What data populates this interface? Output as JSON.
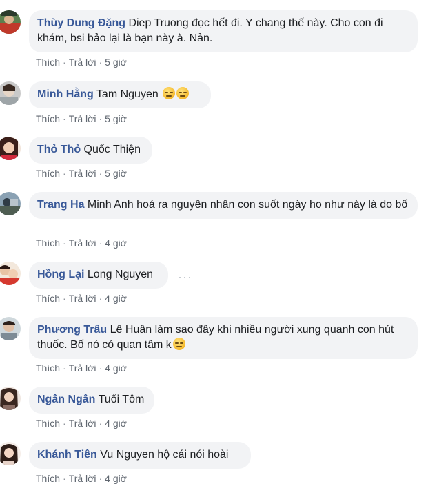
{
  "comments": [
    {
      "author": "Thùy Dung Đặng",
      "text": "Diep Truong đọc hết đi. Y chang thế này. Cho con đi khám, bsi bảo lại là bạn này à. Nản.",
      "like_label": "Thích",
      "reply_label": "Trả lời",
      "time": "5 giờ",
      "has_emoji": false
    },
    {
      "author": "Minh Hằng",
      "text": "Tam Nguyen",
      "like_label": "Thích",
      "reply_label": "Trả lời",
      "time": "5 giờ",
      "emojis": [
        "unamused-emoji",
        "unamused-emoji"
      ]
    },
    {
      "author": "Thỏ Thỏ",
      "text": "Quốc Thiện",
      "like_label": "Thích",
      "reply_label": "Trả lời",
      "time": "5 giờ"
    },
    {
      "author": "Trang Ha",
      "text": "Minh Anh hoá ra nguyên nhân con suốt ngày ho như này là do bố",
      "like_label": "Thích",
      "reply_label": "Trả lời",
      "time": "4 giờ"
    },
    {
      "author": "Hồng Lại",
      "text": "Long Nguyen",
      "like_label": "Thích",
      "reply_label": "Trả lời",
      "time": "4 giờ",
      "more_icon": "more-options-icon"
    },
    {
      "author": "Phương Trâu",
      "text": "Lê Huân làm sao đây khi nhiều người xung quanh con hút thuốc. Bố nó có quan tâm k",
      "like_label": "Thích",
      "reply_label": "Trả lời",
      "time": "4 giờ",
      "emojis": [
        "disappointed-emoji"
      ]
    },
    {
      "author": "Ngân Ngân",
      "text": "Tuổi Tôm",
      "like_label": "Thích",
      "reply_label": "Trả lời",
      "time": "4 giờ"
    },
    {
      "author": "Khánh Tiên",
      "text": "Vu Nguyen hộ cái nói hoài",
      "like_label": "Thích",
      "reply_label": "Trả lời",
      "time": "4 giờ"
    }
  ],
  "separator": "·",
  "colors": {
    "author": "#385898",
    "bubble": "#f2f3f5",
    "meta": "#606770"
  }
}
